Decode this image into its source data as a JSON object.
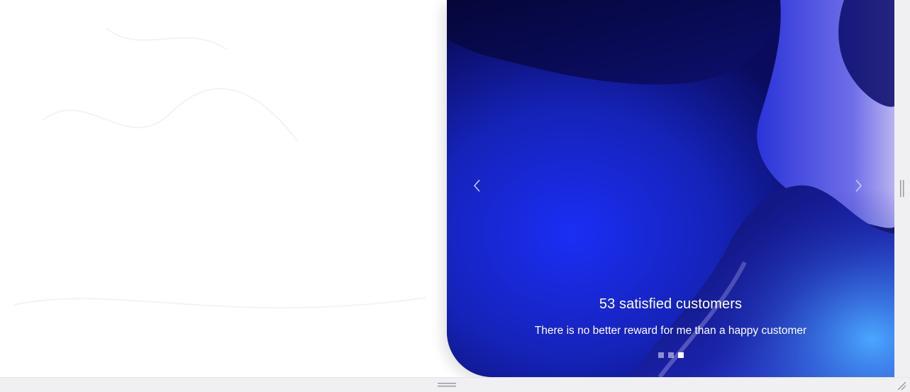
{
  "carousel": {
    "title": "53 satisfied customers",
    "subtitle": "There is no better reward for me than a happy customer",
    "prev_icon": "chevron-left-icon",
    "next_icon": "chevron-right-icon",
    "slide_count": 3,
    "active_slide": 3,
    "colors": {
      "deep_navy": "#0a0b5c",
      "royal_blue": "#1c2ee0",
      "lavender": "#a9a3f0"
    }
  },
  "scrollbars": {
    "vertical_grip_icon": "vertical-grip-icon",
    "horizontal_grip_icon": "horizontal-grip-icon",
    "resize_icon": "resize-corner-icon"
  }
}
